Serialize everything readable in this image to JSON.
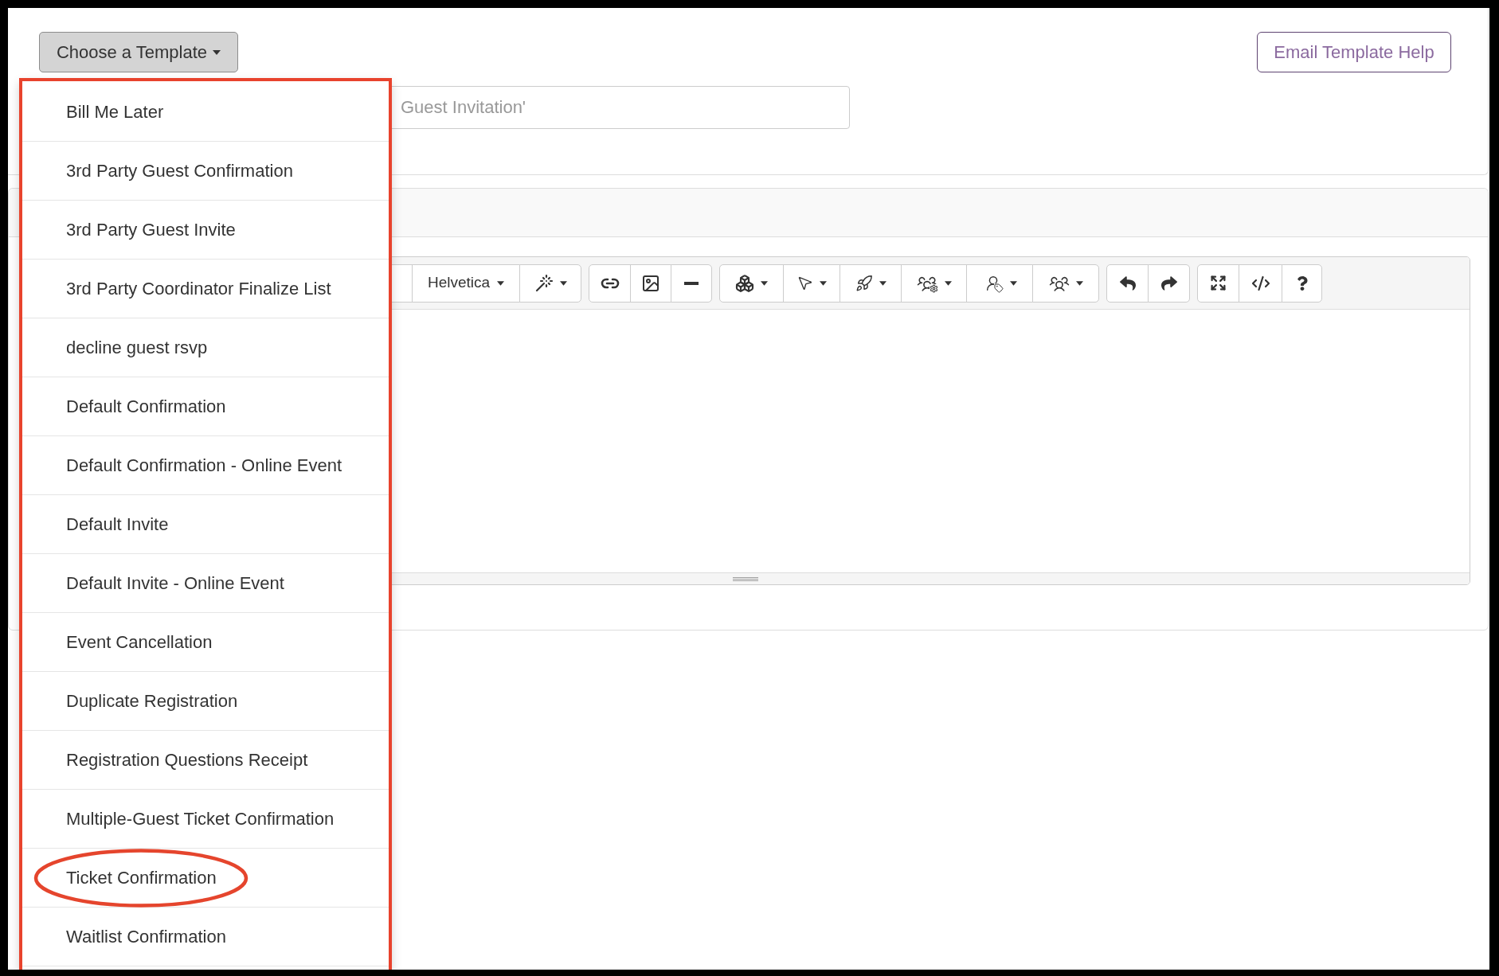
{
  "template_button": {
    "label": "Choose a Template",
    "expanded": true
  },
  "help_button": {
    "label": "Email Template Help"
  },
  "subject_field": {
    "placeholder": "Guest Invitation'"
  },
  "template_menu": {
    "outlined": true,
    "items": [
      {
        "label": "Bill Me Later",
        "circled": false
      },
      {
        "label": "3rd Party Guest Confirmation",
        "circled": false
      },
      {
        "label": "3rd Party Guest Invite",
        "circled": false
      },
      {
        "label": "3rd Party Coordinator Finalize List",
        "circled": false
      },
      {
        "label": "decline guest rsvp",
        "circled": false
      },
      {
        "label": "Default Confirmation",
        "circled": false
      },
      {
        "label": "Default Confirmation - Online Event",
        "circled": false
      },
      {
        "label": "Default Invite",
        "circled": false
      },
      {
        "label": "Default Invite - Online Event",
        "circled": false
      },
      {
        "label": "Event Cancellation",
        "circled": false
      },
      {
        "label": "Duplicate Registration",
        "circled": false
      },
      {
        "label": "Registration Questions Receipt",
        "circled": false
      },
      {
        "label": "Multiple-Guest Ticket Confirmation",
        "circled": false
      },
      {
        "label": "Ticket Confirmation",
        "circled": true
      },
      {
        "label": "Waitlist Confirmation",
        "circled": false
      }
    ]
  },
  "editor": {
    "font_name": "Helvetica"
  }
}
